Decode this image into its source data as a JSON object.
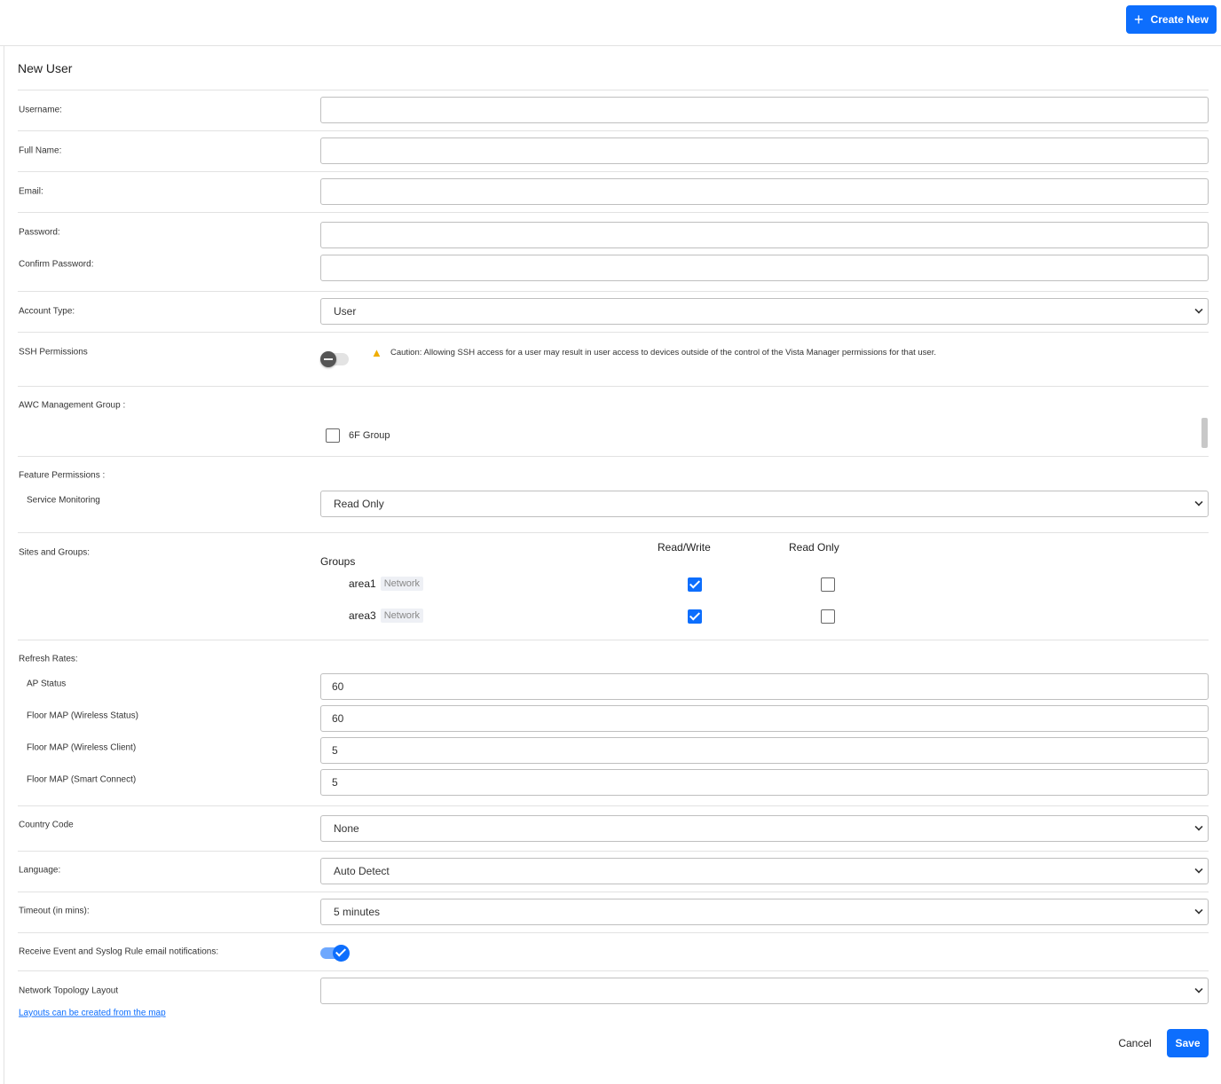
{
  "header": {
    "create_label": "Create New"
  },
  "form": {
    "title": "New User",
    "username_label": "Username:",
    "username_value": "",
    "fullname_label": "Full Name:",
    "fullname_value": "",
    "email_label": "Email:",
    "email_value": "",
    "password_label": "Password:",
    "password_value": "",
    "confirm_label": "Confirm Password:",
    "confirm_value": "",
    "account_type_label": "Account Type:",
    "account_type_value": "User",
    "ssh_label": "SSH Permissions",
    "ssh_enabled": false,
    "ssh_caution": "Caution: Allowing SSH access for a user may result in user access to devices outside of the control of the Vista Manager permissions for that user.",
    "awc_label": "AWC Management Group :",
    "awc_groups": [
      {
        "name": "6F Group",
        "checked": false
      }
    ],
    "feature_label": "Feature Permissions :",
    "service_monitoring_label": "Service Monitoring",
    "service_monitoring_value": "Read Only",
    "sites_label": "Sites and Groups:",
    "groups_header": "Groups",
    "rw_header": "Read/Write",
    "ro_header": "Read Only",
    "groups": [
      {
        "name": "area1",
        "type": "Network",
        "read_write": true,
        "read_only": false
      },
      {
        "name": "area3",
        "type": "Network",
        "read_write": true,
        "read_only": false
      }
    ],
    "refresh_label": "Refresh Rates:",
    "refresh": [
      {
        "label": "AP Status",
        "value": "60"
      },
      {
        "label": "Floor MAP (Wireless Status)",
        "value": "60"
      },
      {
        "label": "Floor MAP (Wireless Client)",
        "value": "5"
      },
      {
        "label": "Floor MAP (Smart Connect)",
        "value": "5"
      }
    ],
    "country_label": "Country Code",
    "country_value": "None",
    "language_label": "Language:",
    "language_value": "Auto Detect",
    "timeout_label": "Timeout (in mins):",
    "timeout_value": "5 minutes",
    "notify_label": "Receive Event and Syslog Rule email notifications:",
    "notify_enabled": true,
    "topology_label": "Network Topology Layout",
    "topology_value": "",
    "topology_link": "Layouts can be created from the map",
    "cancel_label": "Cancel",
    "save_label": "Save"
  }
}
